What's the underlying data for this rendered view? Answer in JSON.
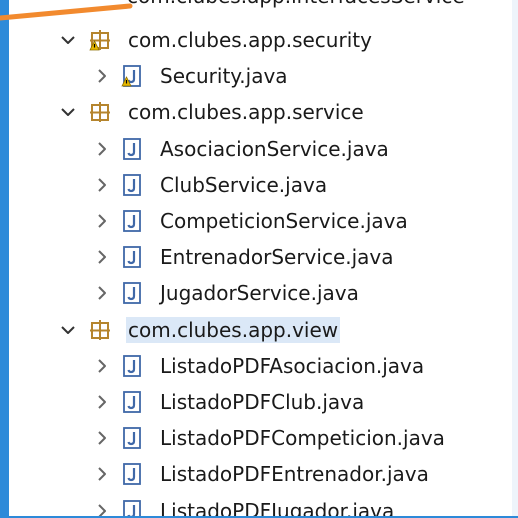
{
  "tree": {
    "partial_top_label": "com.clubes.app.interfacesService",
    "packages": [
      {
        "id": "security",
        "label": "com.clubes.app.security",
        "expanded": true,
        "selected": false,
        "icon": "package-warning-icon",
        "files": [
          {
            "label": "Security.java",
            "icon": "java-file-warning-icon"
          }
        ]
      },
      {
        "id": "service",
        "label": "com.clubes.app.service",
        "expanded": true,
        "selected": false,
        "icon": "package-icon",
        "files": [
          {
            "label": "AsociacionService.java",
            "icon": "java-file-icon"
          },
          {
            "label": "ClubService.java",
            "icon": "java-file-icon"
          },
          {
            "label": "CompeticionService.java",
            "icon": "java-file-icon"
          },
          {
            "label": "EntrenadorService.java",
            "icon": "java-file-icon"
          },
          {
            "label": "JugadorService.java",
            "icon": "java-file-icon"
          }
        ]
      },
      {
        "id": "view",
        "label": "com.clubes.app.view",
        "expanded": true,
        "selected": true,
        "icon": "package-icon",
        "files": [
          {
            "label": "ListadoPDFAsociacion.java",
            "icon": "java-file-icon"
          },
          {
            "label": "ListadoPDFClub.java",
            "icon": "java-file-icon"
          },
          {
            "label": "ListadoPDFCompeticion.java",
            "icon": "java-file-icon"
          },
          {
            "label": "ListadoPDFEntrenador.java",
            "icon": "java-file-icon"
          },
          {
            "label": "ListadoPDFJugador.java",
            "icon": "java-file-icon"
          }
        ]
      }
    ]
  },
  "colors": {
    "accent": "#2d8ad9",
    "annotation": "#f28a2e",
    "selection": "#dbe8f7",
    "package": "#b5852e",
    "java": "#3f68a8",
    "warning": "#e6b800"
  }
}
